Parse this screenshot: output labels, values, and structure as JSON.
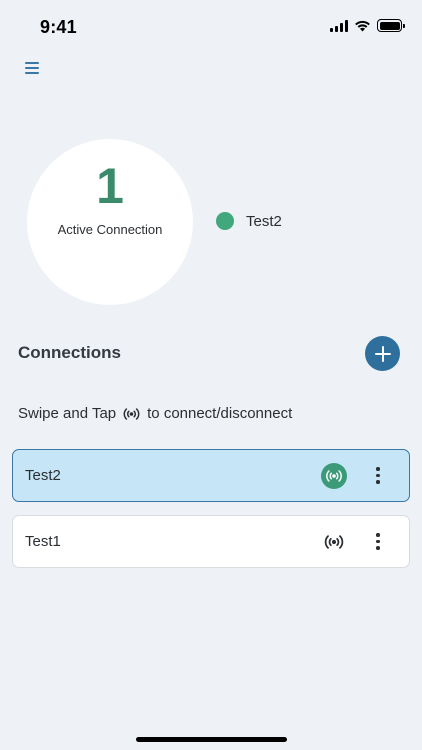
{
  "status_bar": {
    "time": "9:41"
  },
  "summary": {
    "active_count": "1",
    "active_label": "Active Connection",
    "active_items": [
      {
        "label": "Test2",
        "color": "#40a87c"
      }
    ]
  },
  "connections_section": {
    "title": "Connections",
    "instruction_before": "Swipe and Tap",
    "instruction_after": "to connect/disconnect"
  },
  "connections": [
    {
      "name": "Test2",
      "active": true
    },
    {
      "name": "Test1",
      "active": false
    }
  ],
  "colors": {
    "accent": "#2f6f9d",
    "active_green": "#3b9a78",
    "selected_row_bg": "#c6e6f7",
    "background": "#eef1f5"
  },
  "icons": {
    "menu": "hamburger-menu-icon",
    "add": "plus-icon",
    "connect": "broadcast-signal-icon",
    "more": "vertical-ellipsis-icon"
  }
}
